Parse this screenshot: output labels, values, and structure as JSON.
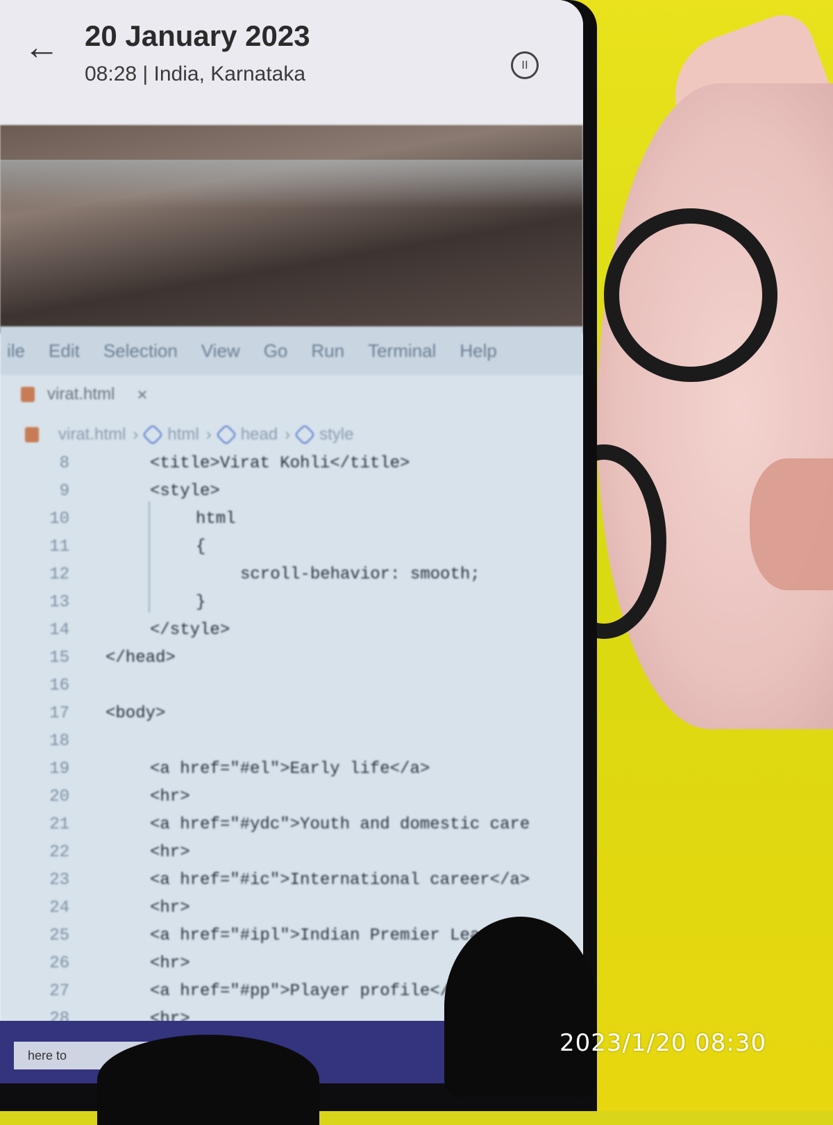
{
  "header": {
    "date_title": "20 January 2023",
    "date_sub": "08:28 | India, Karnataka",
    "back_icon": "back-arrow-icon",
    "pause_icon": "pause-icon"
  },
  "editor": {
    "menu": [
      "ile",
      "Edit",
      "Selection",
      "View",
      "Go",
      "Run",
      "Terminal",
      "Help"
    ],
    "tab_label": "virat.html",
    "tab_close": "×",
    "breadcrumb": [
      "virat.html",
      "html",
      "head",
      "style"
    ],
    "lines": [
      {
        "num": "8",
        "text": "<title>Virat Kohli</title>"
      },
      {
        "num": "9",
        "text": "<style>"
      },
      {
        "num": "10",
        "text": "html"
      },
      {
        "num": "11",
        "text": "{"
      },
      {
        "num": "12",
        "text": "scroll-behavior: smooth;"
      },
      {
        "num": "13",
        "text": "}"
      },
      {
        "num": "14",
        "text": "</style>"
      },
      {
        "num": "15",
        "text": "</head>"
      },
      {
        "num": "16",
        "text": ""
      },
      {
        "num": "17",
        "text": "<body>"
      },
      {
        "num": "18",
        "text": ""
      },
      {
        "num": "19",
        "text": "<a href=\"#el\">Early life</a>"
      },
      {
        "num": "20",
        "text": "<hr>"
      },
      {
        "num": "21",
        "text": "<a href=\"#ydc\">Youth and domestic care"
      },
      {
        "num": "22",
        "text": "<hr>"
      },
      {
        "num": "23",
        "text": "<a href=\"#ic\">International career</a>"
      },
      {
        "num": "24",
        "text": "<hr>"
      },
      {
        "num": "25",
        "text": "<a href=\"#ipl\">Indian Premier Lea"
      },
      {
        "num": "26",
        "text": "<hr>"
      },
      {
        "num": "27",
        "text": "<a href=\"#pp\">Player profile</a"
      },
      {
        "num": "28",
        "text": "<hr>"
      }
    ],
    "taskbar_search": "here to"
  },
  "photo_stamp": "2023/1/20 08:30",
  "colors": {
    "backdrop": "#e0dc16",
    "editor_bg": "#d7e2ea",
    "taskbar": "#34337e"
  }
}
